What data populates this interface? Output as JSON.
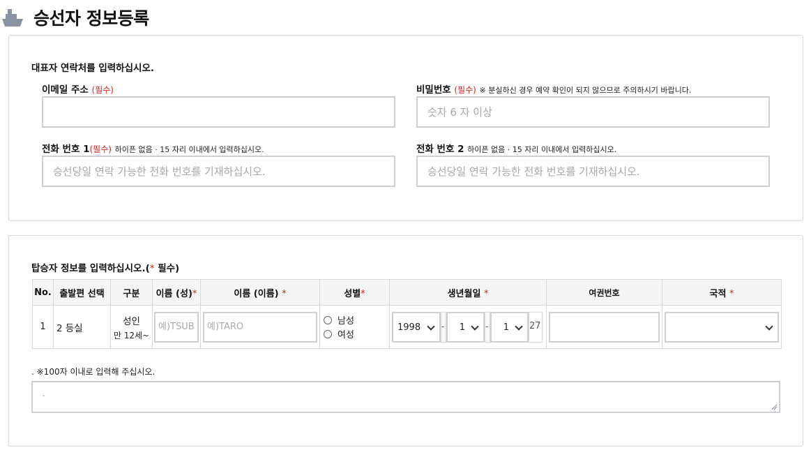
{
  "header": {
    "title": "승선자 정보등록",
    "icon": "ship-icon"
  },
  "contact": {
    "section_title": "대표자 연락처를 입력하십시오.",
    "email": {
      "label": "이메일 주소",
      "required": "(필수)",
      "value": "",
      "placeholder": ""
    },
    "password": {
      "label": "비밀번호",
      "required": "(필수)",
      "note": "※ 분실하신 경우 예약 확인이 되지 않으므로 주의하시기 바랍니다.",
      "placeholder": "숫자 6 자 이상"
    },
    "phone1": {
      "label": "전화 번호 1",
      "required": "(필수)",
      "note": "하이픈 없음 · 15 자리 이내에서 입력하십시오.",
      "placeholder": "승선당일 연락 가능한 전화 번호를 기재하십시오."
    },
    "phone2": {
      "label": "전화 번호 2",
      "note": "하이픈 없음 · 15 자리 이내에서 입력하십시오.",
      "placeholder": "승선당일 연락 가능한 전화 번호를 기재하십시오."
    }
  },
  "passengers": {
    "section_title_prefix": "탑승자 정보를 입력하십시오.(",
    "section_title_star": "*",
    "section_title_suffix": " 필수)",
    "columns": {
      "no": "No.",
      "departure": "출발편 선택",
      "type": "구분",
      "last_name": "이름 (성)",
      "first_name": "이름 (이름)",
      "gender": "성별",
      "birthdate": "생년월일",
      "passport": "여권번호",
      "nationality": "국적",
      "required_mark": "*"
    },
    "rows": [
      {
        "no": "1",
        "departure": "2 등실",
        "type": "성인",
        "type_sub": "만 12세~",
        "last_name_placeholder": "예)TSUBASA",
        "first_name_placeholder": "예)TARO",
        "gender_options": [
          "남성",
          "여성"
        ],
        "birth_year": "1998",
        "birth_month": "1",
        "birth_day": "1",
        "age": "27",
        "birth_separator": "-",
        "passport": "",
        "nationality": ""
      }
    ]
  },
  "remarks": {
    "note": ". ※100자 이내로 입력해 주십시오.",
    "value": "."
  }
}
